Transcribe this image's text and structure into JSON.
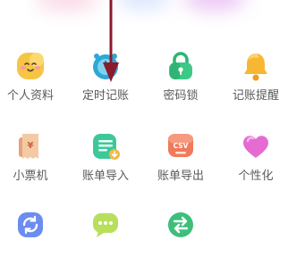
{
  "features": [
    {
      "label": "个人资料",
      "icon": "smiley-face-icon"
    },
    {
      "label": "定时记账",
      "icon": "alarm-clock-icon"
    },
    {
      "label": "密码锁",
      "icon": "padlock-icon"
    },
    {
      "label": "记账提醒",
      "icon": "bell-icon"
    },
    {
      "label": "小票机",
      "icon": "receipt-printer-icon"
    },
    {
      "label": "账单导入",
      "icon": "document-import-icon"
    },
    {
      "label": "账单导出",
      "icon": "csv-export-icon"
    },
    {
      "label": "个性化",
      "icon": "heart-icon"
    },
    {
      "label": "",
      "icon": "sync-icon"
    },
    {
      "label": "",
      "icon": "chat-bubble-icon"
    },
    {
      "label": "",
      "icon": "swap-arrows-icon"
    }
  ],
  "csv_badge_text": "CSV",
  "colors": {
    "label_text": "#5a5a5a",
    "arrow": "#8b1a2b"
  }
}
